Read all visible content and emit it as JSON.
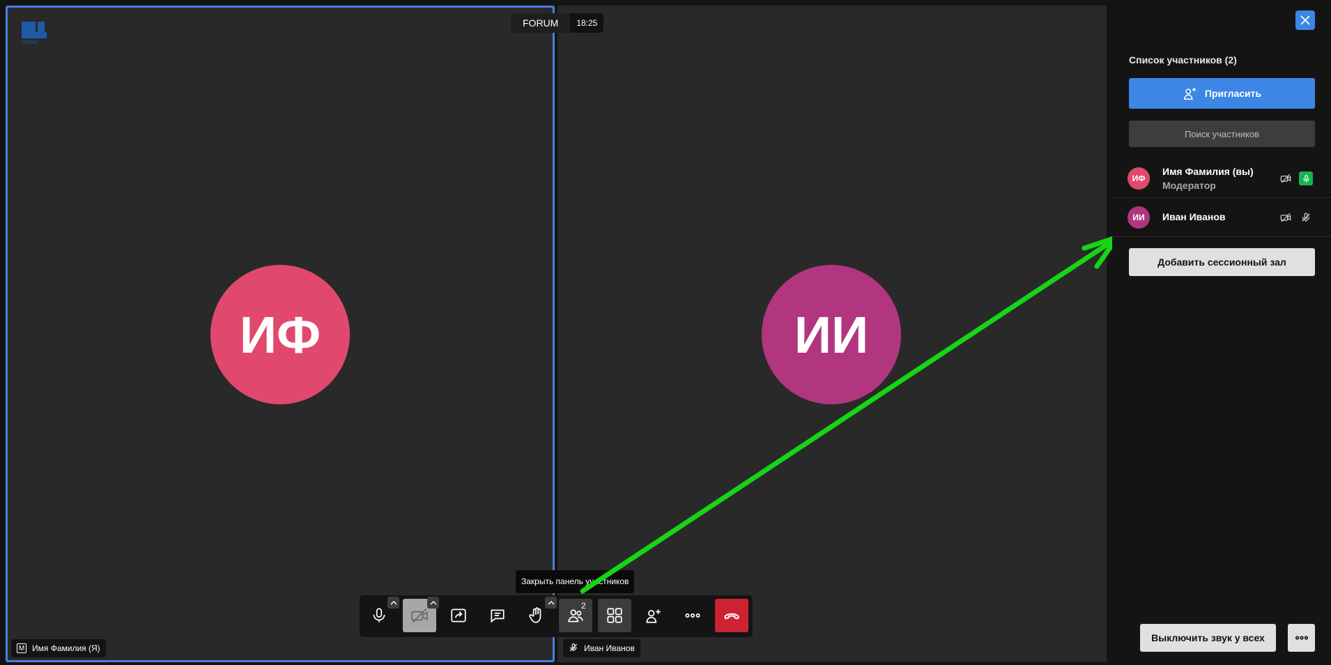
{
  "colors": {
    "accent": "#3d86e5",
    "active_speaker_border": "#4a7fe5",
    "avatar_self": "#e0496d",
    "avatar_other": "#b2357f",
    "end_call": "#cc2232",
    "mic_on": "#18b350",
    "annotation_arrow": "#16d516"
  },
  "header": {
    "logo_text": "НБИКС",
    "room_name": "FORUM",
    "time": "18:25"
  },
  "tiles": [
    {
      "initials": "ИФ",
      "name": "Имя Фамилия (Я)",
      "badge": "M"
    },
    {
      "initials": "ИИ",
      "name": "Иван Иванов"
    }
  ],
  "toolbar": {
    "participants_count": "2",
    "tooltip": "Закрыть панель участников",
    "buttons": [
      "microphone-icon",
      "camera-off-icon",
      "share-screen-icon",
      "chat-icon",
      "raise-hand-icon",
      "participants-icon",
      "tile-view-icon",
      "invite-icon",
      "more-icon",
      "hangup-icon"
    ]
  },
  "panel": {
    "title": "Список участников (2)",
    "invite_label": "Пригласить",
    "search_placeholder": "Поиск участников",
    "participants": [
      {
        "initials": "ИФ",
        "name": "Имя Фамилия (вы)",
        "role": "Модератор",
        "mic": "on",
        "camera": "off"
      },
      {
        "initials": "ИИ",
        "name": "Иван Иванов",
        "mic": "muted",
        "camera": "off"
      }
    ],
    "breakout_label": "Добавить сессионный зал",
    "mute_all_label": "Выключить звук у всех"
  }
}
